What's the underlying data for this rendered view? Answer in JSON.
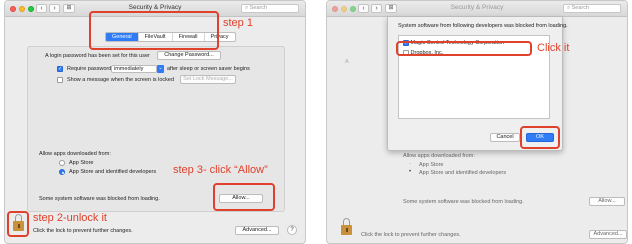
{
  "window": {
    "title": "Security & Privacy",
    "search_placeholder": "Search",
    "tabs": [
      "General",
      "FileVault",
      "Firewall",
      "Privacy"
    ],
    "login_password_text": "A login password has been set for this user",
    "change_password_label": "Change Password...",
    "require_password_label": "Require password",
    "require_password_value": "immediately",
    "after_sleep_text": "after sleep or screen saver begins",
    "show_message_label": "Show a message when the screen is locked",
    "set_lock_message_label": "Set Lock Message...",
    "allow_apps_label": "Allow apps downloaded from:",
    "option_app_store": "App Store",
    "option_identified": "App Store and identified developers",
    "blocked_text": "Some system software was blocked from loading.",
    "allow_label": "Allow...",
    "lock_text": "Click the lock to prevent further changes.",
    "advanced_label": "Advanced...",
    "help_label": "?"
  },
  "dialog": {
    "message": "System software from following developers was blocked from loading.",
    "items": [
      {
        "label": "Magic Control Technology Corporation",
        "checked": true
      },
      {
        "label": "Dropbox, Inc.",
        "checked": false
      }
    ],
    "cancel_label": "Cancel",
    "ok_label": "OK"
  },
  "annotations": {
    "step1": "step 1",
    "step2": "step 2-unlock it",
    "step3": "step 3- click “Allow”",
    "click_it": "Click it"
  },
  "colors": {
    "accent": "#2f7cf6",
    "annotation": "#e0412c"
  }
}
